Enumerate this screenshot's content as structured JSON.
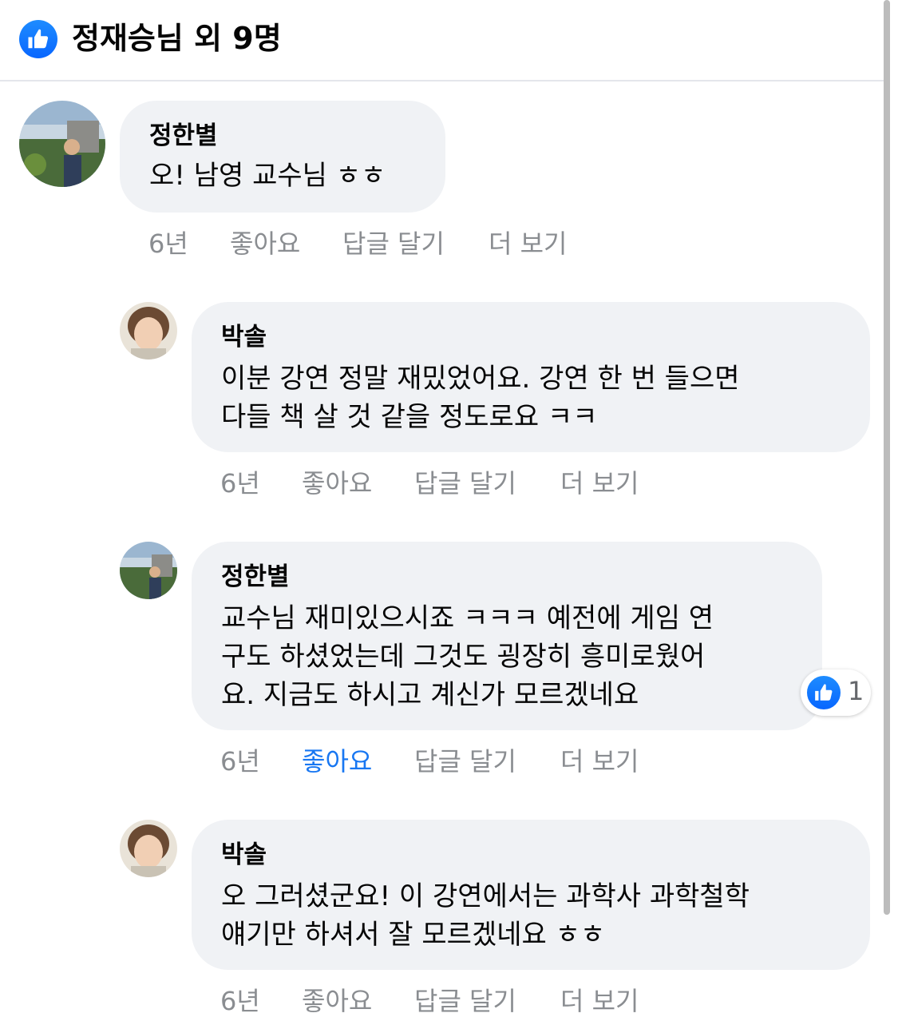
{
  "header": {
    "title": "정재승님 외 9명",
    "icon": "like-icon"
  },
  "colors": {
    "like_blue": "#1877f2",
    "bubble_bg": "#f0f2f5",
    "meta_gray": "#8a8d91"
  },
  "comments": [
    {
      "author": "정한별",
      "lines": [
        "오! 남영 교수님 ㅎㅎ"
      ],
      "time": "6년",
      "like": "좋아요",
      "reply": "답글 달기",
      "more": "더 보기",
      "liked": false
    },
    {
      "author": "박솔",
      "lines": [
        "이분 강연 정말 재밌었어요. 강연 한 번 들으면",
        "다들 책 살 것 같을 정도로요 ㅋㅋ"
      ],
      "time": "6년",
      "like": "좋아요",
      "reply": "답글 달기",
      "more": "더 보기",
      "liked": false
    },
    {
      "author": "정한별",
      "lines": [
        "교수님 재미있으시죠 ㅋㅋㅋ 예전에 게임 연",
        "구도 하셨었는데 그것도 굉장히 흥미로웠어",
        "요. 지금도 하시고 계신가 모르겠네요"
      ],
      "time": "6년",
      "like": "좋아요",
      "reply": "답글 달기",
      "more": "더 보기",
      "liked": true,
      "reaction_count": "1"
    },
    {
      "author": "박솔",
      "lines": [
        "오 그러셨군요! 이 강연에서는 과학사 과학철학",
        "얘기만 하셔서 잘 모르겠네요 ㅎㅎ"
      ],
      "time": "6년",
      "like": "좋아요",
      "reply": "답글 달기",
      "more": "더 보기",
      "liked": false
    }
  ]
}
